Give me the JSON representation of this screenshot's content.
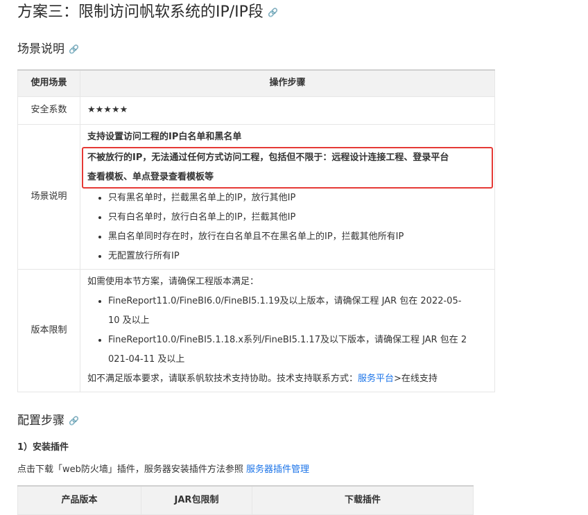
{
  "heading": "方案三：限制访问帆软系统的IP/IP段",
  "anchor_icon": "link-icon",
  "section_scene": "场景说明",
  "table1": {
    "headers": [
      "使用场景",
      "操作步骤"
    ],
    "rows": {
      "safety": {
        "label": "安全系数",
        "value": "★★★★★"
      },
      "scene": {
        "label": "场景说明",
        "intro": "支持设置访问工程的IP白名单和黑名单",
        "highlight_line1": "不被放行的IP，无法通过任何方式访问工程，包括但不限于：远程设计连接工程、登录平台",
        "highlight_line2": "查看模板、单点登录查看模板等",
        "bullets": [
          "只有黑名单时，拦截黑名单上的IP，放行其他IP",
          "只有白名单时，放行白名单上的IP，拦截其他IP",
          "黑白名单同时存在时，放行在白名单且不在黑名单上的IP，拦截其他所有IP",
          "无配置放行所有IP"
        ]
      },
      "version": {
        "label": "版本限制",
        "intro": "如需使用本节方案，请确保工程版本满足：",
        "bullet1_line1": "FineReport11.0/FineBI6.0/FineBI5.1.19及以上版本，请确保工程 JAR 包在 2022-05-",
        "bullet1_line2": "10 及以上",
        "bullet2_line1": "FineReport10.0/FineBI5.1.18.x系列/FineBI5.1.17及以下版本，请确保工程 JAR 包在 2",
        "bullet2_line2": "021-04-11 及以上",
        "footer_text": "如不满足版本要求，请联系帆软技术支持协助。技术支持联系方式：",
        "footer_link": "服务平台",
        "footer_tail": ">在线支持"
      }
    }
  },
  "section_config": "配置步骤",
  "step1": {
    "title": "1）安装插件",
    "text": "点击下载「web防火墙」插件，服务器安装插件方法参照 ",
    "link": "服务器插件管理"
  },
  "table2": {
    "headers": [
      "产品版本",
      "JAR包限制",
      "下载插件"
    ]
  }
}
